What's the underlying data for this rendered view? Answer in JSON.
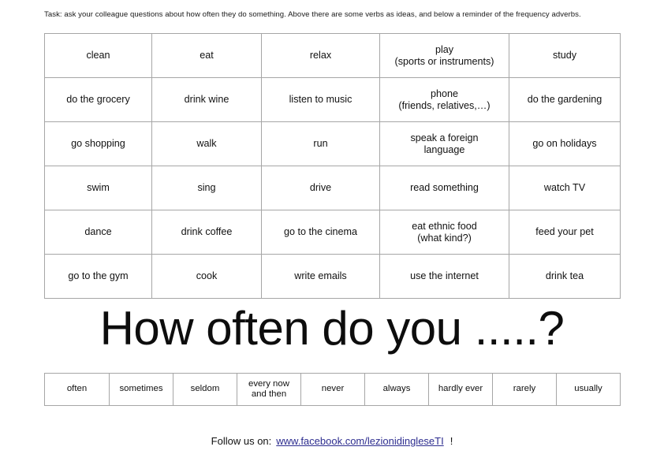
{
  "task": {
    "instruction": "Task: ask your colleague questions about how often they do something. Above there are some verbs as ideas, and below a reminder of the frequency adverbs."
  },
  "verbs_table": {
    "rows": [
      [
        {
          "line1": "clean",
          "line2": ""
        },
        {
          "line1": "eat",
          "line2": ""
        },
        {
          "line1": "relax",
          "line2": ""
        },
        {
          "line1": "play",
          "line2": "(sports or instruments)"
        },
        {
          "line1": "study",
          "line2": ""
        }
      ],
      [
        {
          "line1": "do the grocery",
          "line2": ""
        },
        {
          "line1": "drink wine",
          "line2": ""
        },
        {
          "line1": "listen to music",
          "line2": ""
        },
        {
          "line1": "phone",
          "line2": "(friends, relatives,…)"
        },
        {
          "line1": "do the gardening",
          "line2": ""
        }
      ],
      [
        {
          "line1": "go shopping",
          "line2": ""
        },
        {
          "line1": "walk",
          "line2": ""
        },
        {
          "line1": "run",
          "line2": ""
        },
        {
          "line1": "speak a foreign",
          "line2": "language"
        },
        {
          "line1": "go on holidays",
          "line2": ""
        }
      ],
      [
        {
          "line1": "swim",
          "line2": ""
        },
        {
          "line1": "sing",
          "line2": ""
        },
        {
          "line1": "drive",
          "line2": ""
        },
        {
          "line1": "read something",
          "line2": ""
        },
        {
          "line1": "watch TV",
          "line2": ""
        }
      ],
      [
        {
          "line1": "dance",
          "line2": ""
        },
        {
          "line1": "drink coffee",
          "line2": ""
        },
        {
          "line1": "go to the cinema",
          "line2": ""
        },
        {
          "line1": "eat ethnic food",
          "line2": "(what kind?)"
        },
        {
          "line1": "feed your pet",
          "line2": ""
        }
      ],
      [
        {
          "line1": "go to the gym",
          "line2": ""
        },
        {
          "line1": "cook",
          "line2": ""
        },
        {
          "line1": "write emails",
          "line2": ""
        },
        {
          "line1": "use the internet",
          "line2": ""
        },
        {
          "line1": "drink tea",
          "line2": ""
        }
      ]
    ]
  },
  "headline": {
    "text": "How often do you .....?"
  },
  "adverbs_table": {
    "cells": [
      {
        "line1": "often",
        "line2": ""
      },
      {
        "line1": "sometimes",
        "line2": ""
      },
      {
        "line1": "seldom",
        "line2": ""
      },
      {
        "line1": "every now",
        "line2": "and then"
      },
      {
        "line1": "never",
        "line2": ""
      },
      {
        "line1": "always",
        "line2": ""
      },
      {
        "line1": "hardly ever",
        "line2": ""
      },
      {
        "line1": "rarely",
        "line2": ""
      },
      {
        "line1": "usually",
        "line2": ""
      }
    ]
  },
  "footer": {
    "prefix": "Follow us on:",
    "link_text": "www.facebook.com/lezionidingleseTI",
    "suffix": "!",
    "link_color": "#2d2d8f"
  },
  "colors": {
    "border": "#a6a6a6",
    "text": "#111111",
    "background": "#ffffff"
  }
}
